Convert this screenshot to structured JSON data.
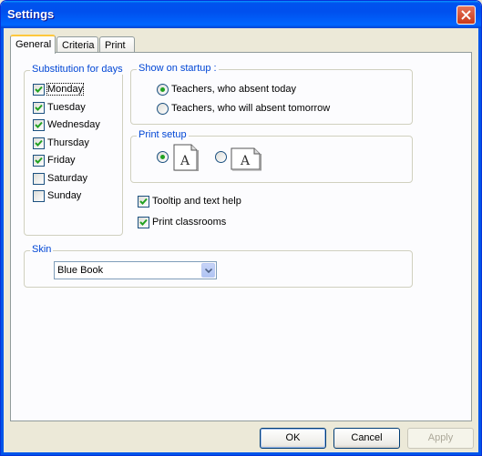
{
  "window": {
    "title": "Settings"
  },
  "tabs": [
    {
      "label": "General",
      "active": true
    },
    {
      "label": "Criteria",
      "active": false
    },
    {
      "label": "Print",
      "active": false
    }
  ],
  "substitution": {
    "label": "Substitution for days",
    "days": [
      {
        "label": "Monday",
        "checked": true
      },
      {
        "label": "Tuesday",
        "checked": true
      },
      {
        "label": "Wednesday",
        "checked": true
      },
      {
        "label": "Thursday",
        "checked": true
      },
      {
        "label": "Friday",
        "checked": true
      },
      {
        "label": "Saturday",
        "checked": false
      },
      {
        "label": "Sunday",
        "checked": false
      }
    ]
  },
  "startup": {
    "label": "Show on startup :",
    "options": [
      {
        "label": "Teachers, who absent today",
        "selected": true
      },
      {
        "label": "Teachers, who will absent tomorrow",
        "selected": false
      }
    ]
  },
  "print_setup": {
    "label": "Print setup",
    "options": [
      {
        "orientation": "portrait",
        "icon_letter": "A",
        "selected": true
      },
      {
        "orientation": "landscape",
        "icon_letter": "A",
        "selected": false
      }
    ]
  },
  "options": {
    "tooltip_label": "Tooltip and text help",
    "tooltip_checked": true,
    "classrooms_label": "Print classrooms",
    "classrooms_checked": true
  },
  "skin": {
    "label": "Skin",
    "selected": "Blue Book"
  },
  "buttons": {
    "ok": "OK",
    "cancel": "Cancel",
    "apply": "Apply"
  },
  "colors": {
    "titlebar": "#0054e3",
    "group_label": "#0046d5",
    "radio_dot": "#21a121",
    "check_mark": "#21a121"
  }
}
